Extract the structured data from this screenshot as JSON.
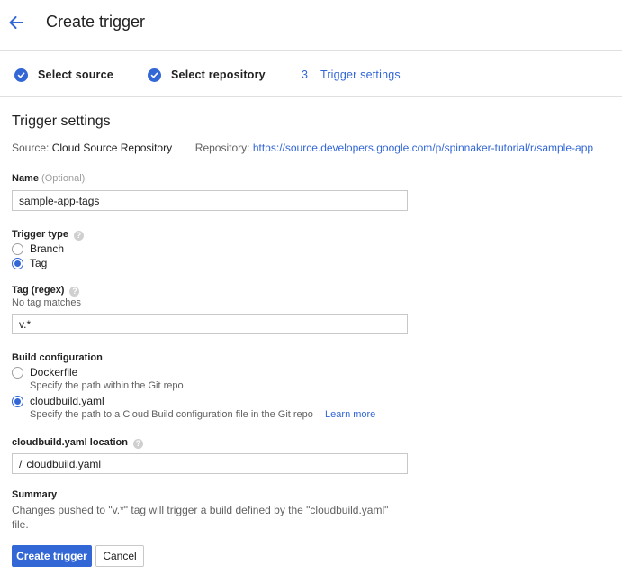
{
  "header": {
    "title": "Create trigger",
    "back_icon": "arrow-left-icon"
  },
  "stepper": {
    "steps": [
      {
        "label": "Select source",
        "state": "done"
      },
      {
        "label": "Select repository",
        "state": "done"
      },
      {
        "number": "3",
        "label": "Trigger settings",
        "state": "active"
      }
    ]
  },
  "form": {
    "title": "Trigger settings",
    "source_label": "Source:",
    "source_value": "Cloud Source Repository",
    "repository_label": "Repository:",
    "repository_url": "https://source.developers.google.com/p/spinnaker-tutorial/r/sample-app",
    "name": {
      "label": "Name",
      "optional": "(Optional)",
      "value": "sample-app-tags"
    },
    "trigger_type": {
      "label": "Trigger type",
      "options": [
        "Branch",
        "Tag"
      ],
      "selected": "Tag"
    },
    "tag_regex": {
      "label": "Tag (regex)",
      "note": "No tag matches",
      "value": "v.*"
    },
    "build_config": {
      "label": "Build configuration",
      "options": [
        {
          "label": "Dockerfile",
          "desc": "Specify the path within the Git repo"
        },
        {
          "label": "cloudbuild.yaml",
          "desc": "Specify the path to a Cloud Build configuration file in the Git repo",
          "link": "Learn more"
        }
      ],
      "selected": "cloudbuild.yaml"
    },
    "location": {
      "label": "cloudbuild.yaml location",
      "prefix": "/",
      "value": "cloudbuild.yaml"
    },
    "summary": {
      "label": "Summary",
      "text": "Changes pushed to \"v.*\" tag will trigger a build defined by the \"cloudbuild.yaml\" file."
    },
    "buttons": {
      "create": "Create trigger",
      "cancel": "Cancel"
    }
  },
  "colors": {
    "accent": "#3367d6",
    "text": "#212121",
    "muted": "#616161",
    "border": "#e0e0e0"
  }
}
